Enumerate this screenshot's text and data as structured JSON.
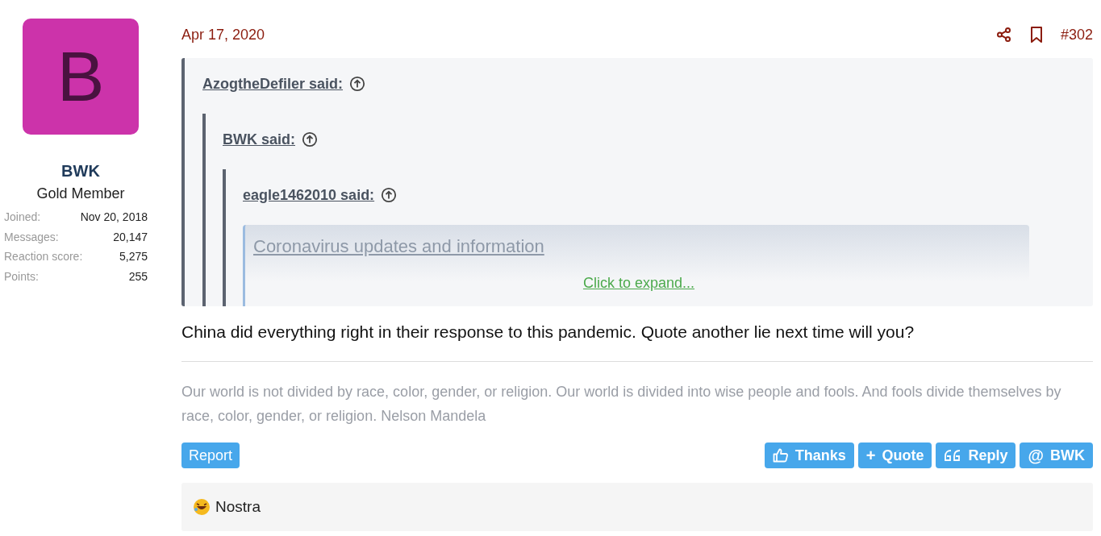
{
  "author": {
    "avatar_letter": "B",
    "name": "BWK",
    "title": "Gold Member",
    "stats": [
      {
        "label": "Joined:",
        "value": "Nov 20, 2018"
      },
      {
        "label": "Messages:",
        "value": "20,147"
      },
      {
        "label": "Reaction score:",
        "value": "5,275"
      },
      {
        "label": "Points:",
        "value": "255"
      }
    ]
  },
  "post": {
    "date": "Apr 17, 2020",
    "number": "#302",
    "quote": {
      "attribution": "AzogtheDefiler said:",
      "children": [
        {
          "attribution": "BWK said:",
          "children": [
            {
              "attribution": "eagle1462010 said:",
              "link_title": "Coronavirus updates and information"
            }
          ]
        }
      ]
    },
    "expand_link": "Click to expand...",
    "body": "China did everything right in their response to this pandemic. Quote another lie next time will you?",
    "signature": "Our world is not divided by race, color, gender, or religion. Our world is divided into wise people and fools. And fools divide themselves by race, color, gender, or religion. Nelson Mandela",
    "report": "Report",
    "actions": [
      {
        "kind": "thanks",
        "label": "Thanks"
      },
      {
        "kind": "quote",
        "icon": "+",
        "label": "Quote"
      },
      {
        "kind": "reply",
        "label": "Reply"
      },
      {
        "kind": "mention",
        "icon": "@",
        "label": "BWK"
      }
    ],
    "reactions": {
      "users": "Nostra"
    }
  }
}
